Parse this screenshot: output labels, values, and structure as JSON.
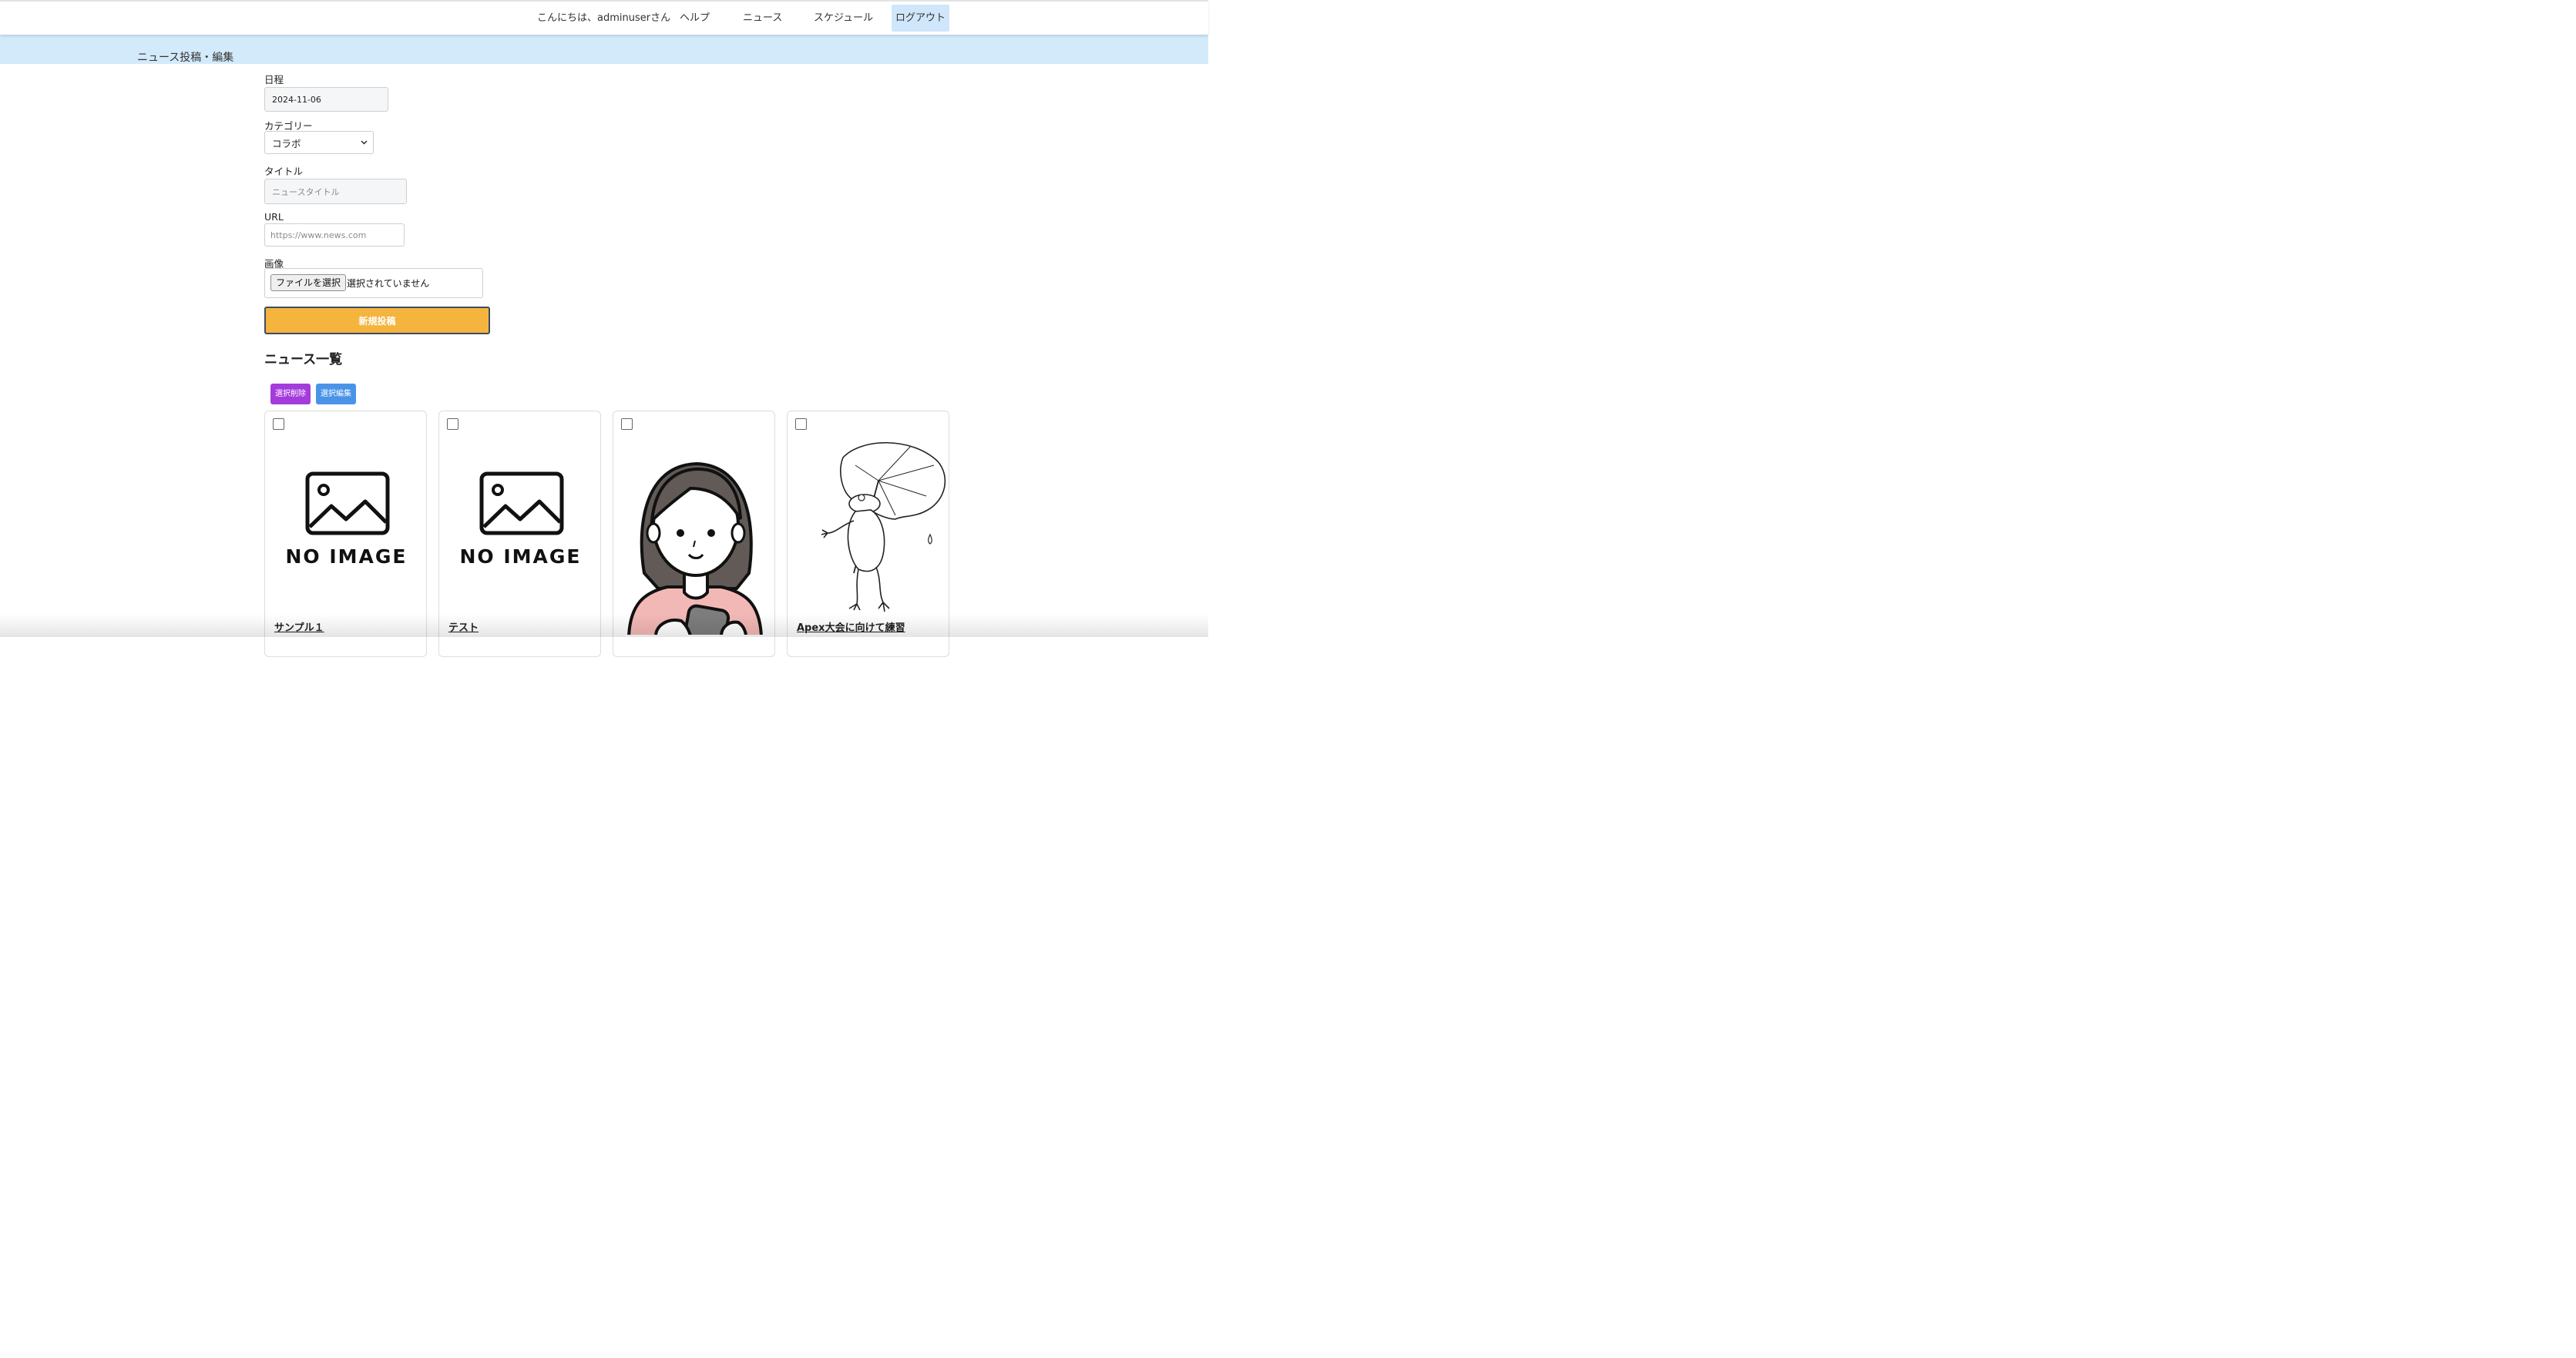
{
  "header": {
    "greeting": "こんにちは、adminuserさん",
    "nav": {
      "help": "ヘルプ",
      "news": "ニュース",
      "schedule": "スケジュール",
      "logout": "ログアウト"
    }
  },
  "subheader": {
    "title": "ニュース投稿・編集"
  },
  "form": {
    "date_label": "日程",
    "date_value": "2024-11-06",
    "category_label": "カテゴリー",
    "category_value": "コラボ",
    "title_label": "タイトル",
    "title_placeholder": "ニュースタイトル",
    "url_label": "URL",
    "url_placeholder": "https://www.news.com",
    "image_label": "画像",
    "file_button": "ファイルを選択",
    "file_status": "選択されていません",
    "submit": "新規投稿"
  },
  "list": {
    "title": "ニュース一覧",
    "delete_button": "選択削除",
    "edit_button": "選択編集",
    "colors": {
      "delete": "#a43cdc",
      "edit": "#4a94e8",
      "submit": "#f4b43e",
      "logout_bg": "#cfe6fb",
      "subheader_bg": "#d3eafa"
    },
    "cards": [
      {
        "title": "サンプル１",
        "image": "no-image",
        "image_text": "NO IMAGE"
      },
      {
        "title": "テスト",
        "image": "no-image",
        "image_text": "NO IMAGE"
      },
      {
        "title": "",
        "image": "woman-with-smartphone-illustration"
      },
      {
        "title": "Apex大会に向けて練習",
        "image": "frog-with-leaf-umbrella-illustration"
      }
    ]
  }
}
